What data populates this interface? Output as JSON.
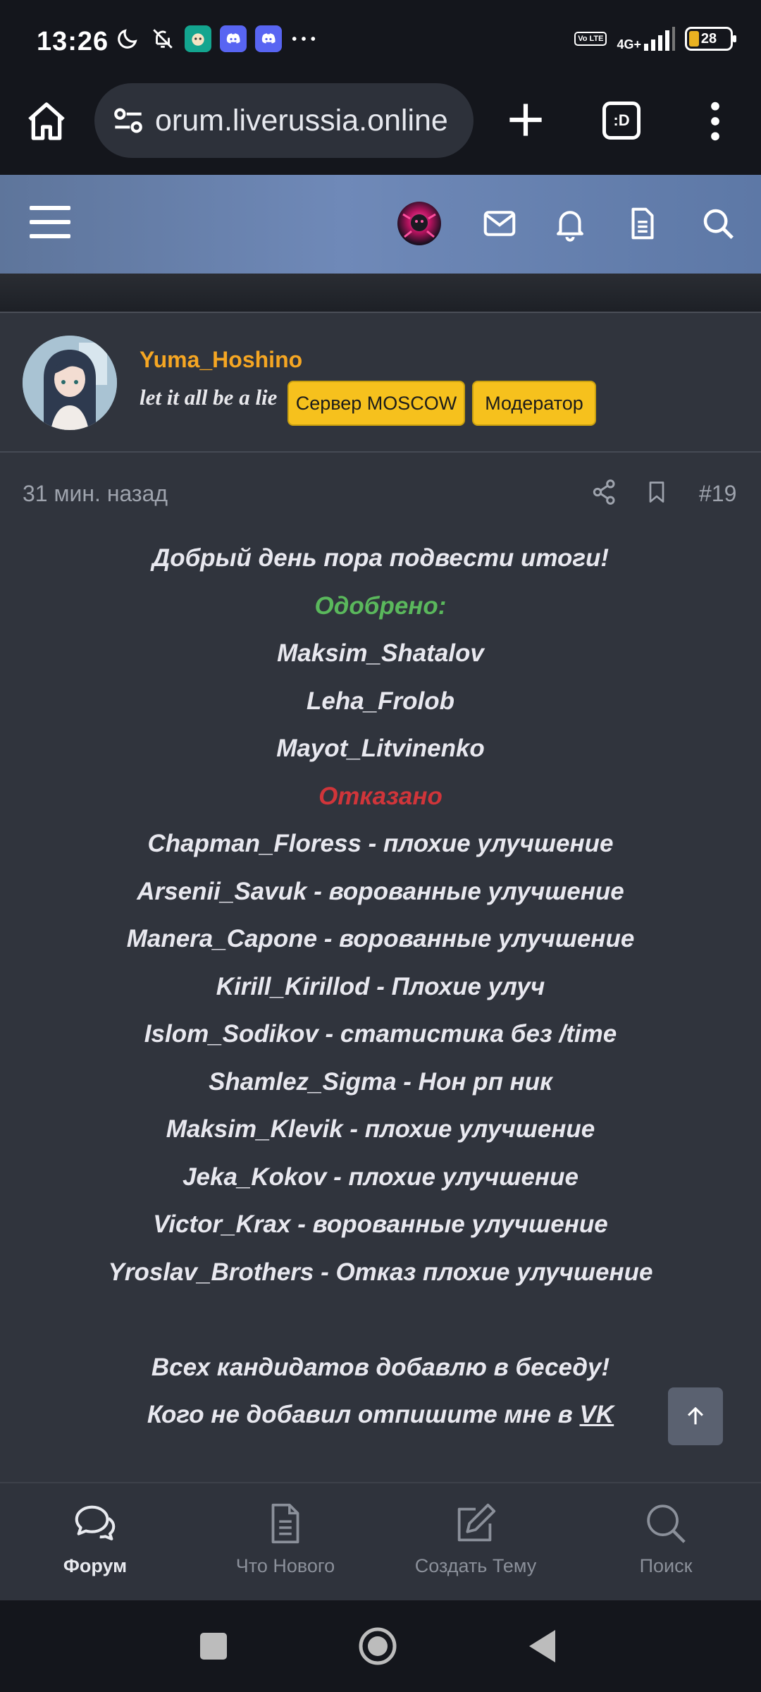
{
  "status_bar": {
    "time": "13:26",
    "icons": [
      "moon-icon",
      "bell-off-icon",
      "app-icon",
      "discord-icon",
      "discord-icon",
      "more-icon"
    ],
    "network": "4G+",
    "volte": "Vo LTE",
    "battery": "28"
  },
  "browser": {
    "url": "orum.liverussia.online",
    "tabs_label": ":D"
  },
  "post": {
    "author": "Yuma_Hoshino",
    "user_title": "let it all be a lie",
    "badges": [
      "Сервер MOSCOW",
      "Модератор"
    ],
    "time": "31 мин. назад",
    "number": "#19",
    "lines": [
      "Добрый день пора подвести итоги!",
      "Одобрено:",
      "Maksim_Shatalov",
      "Leha_Frolob",
      "Mayot_Litvinenko",
      "Отказано",
      "Chapman_Floress - плохие улучшение",
      "Arsenii_Savuk - ворованные улучшение",
      "Manera_Capone - ворованные улучшение",
      "Kirill_Kirillod - Плохие улуч",
      "Islom_Sodikov - статистика без /time",
      "Shamlez_Sigma - Нон рп ник",
      "Maksim_Klevik - плохие улучшение",
      "Jeka_Kokov - плохие улучшение",
      "Victor_Krax - ворованные улучшение",
      "Yroslav_Brothers - Отказ плохие улучшение",
      "",
      "Всех кандидатов добавлю в беседу!",
      "Кого не добавил отпишите мне в ",
      "VK"
    ],
    "colors": {
      "approved": "#5ab85c",
      "denied": "#d0353a",
      "author": "#f5a623",
      "badge": "#f6c11d"
    }
  },
  "tabs": [
    {
      "label": "Форум",
      "icon": "chat-bubbles-icon"
    },
    {
      "label": "Что Нового",
      "icon": "document-icon"
    },
    {
      "label": "Создать Тему",
      "icon": "edit-icon"
    },
    {
      "label": "Поиск",
      "icon": "search-icon"
    }
  ]
}
